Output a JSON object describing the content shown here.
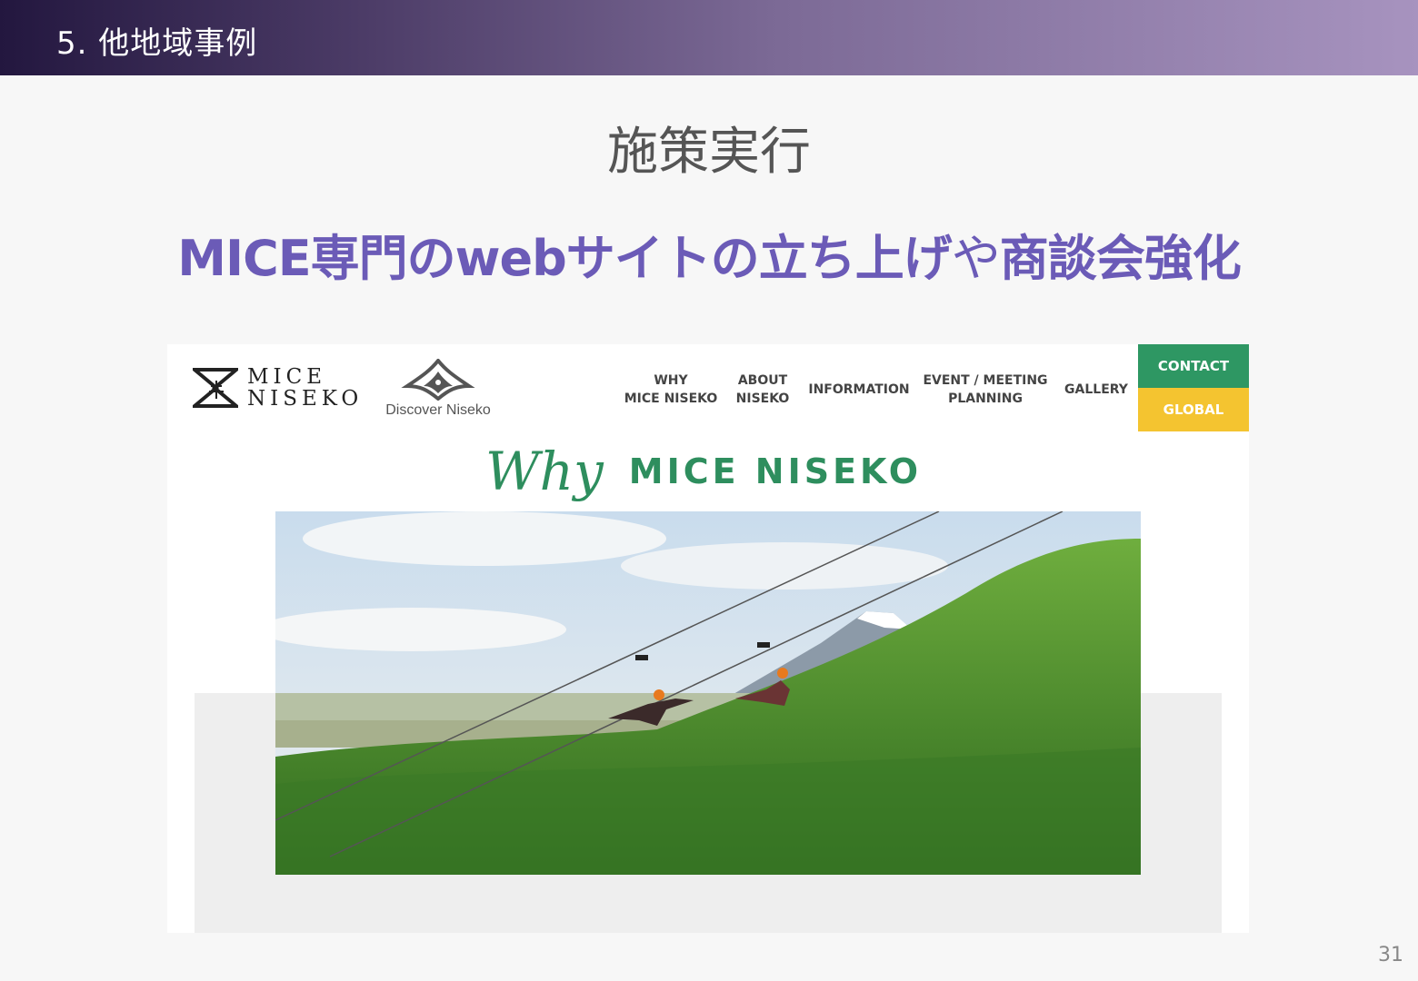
{
  "slide": {
    "section_title": "5. 他地域事例",
    "heading": "施策実行",
    "subheading_part1": "MICE専門のwebサイトの立ち上げ",
    "subheading_part2": "や",
    "subheading_part3": "商談会強化",
    "page_number": "31"
  },
  "website": {
    "logo_line1": "MICE",
    "logo_line2": "NISEKO",
    "discover_caption": "Discover Niseko",
    "nav": [
      {
        "line1": "WHY",
        "line2": "MICE NISEKO"
      },
      {
        "line1": "ABOUT",
        "line2": "NISEKO"
      },
      {
        "line1": "INFORMATION",
        "line2": ""
      },
      {
        "line1": "EVENT / MEETING",
        "line2": "PLANNING"
      },
      {
        "line1": "GALLERY",
        "line2": ""
      }
    ],
    "contact_label": "CONTACT",
    "global_label": "GLOBAL",
    "why_script": "Why",
    "why_main": "MICE NISEKO"
  },
  "colors": {
    "accent_purple": "#6b5bb7",
    "brand_green": "#2e9763",
    "brand_yellow": "#f4c430"
  }
}
